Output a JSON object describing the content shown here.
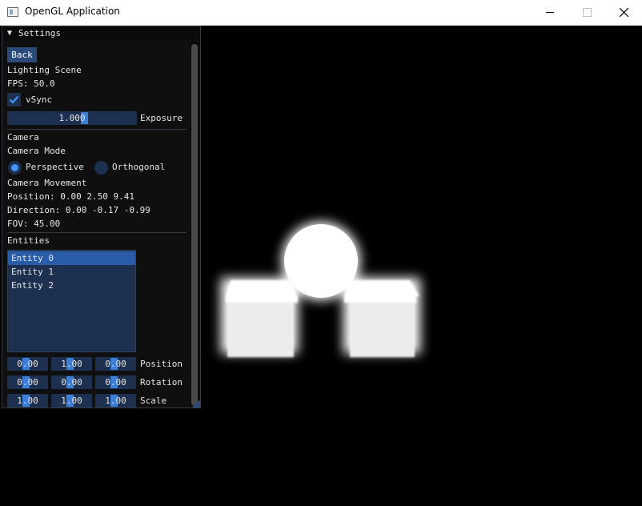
{
  "window": {
    "title": "OpenGL Application",
    "icons": {
      "app": "window-app-icon",
      "minimize": "minimize-icon",
      "maximize": "maximize-icon",
      "close": "close-icon"
    }
  },
  "settings": {
    "title": "Settings",
    "back_label": "Back",
    "scene_name": "Lighting Scene",
    "fps": "FPS: 50.0",
    "vsync_label": "vSync",
    "vsync_checked": true,
    "exposure_value": "1.000",
    "exposure_label": "Exposure",
    "camera": {
      "header": "Camera",
      "mode_label": "Camera Mode",
      "mode_options": [
        "Perspective",
        "Orthogonal"
      ],
      "selected_mode": "Perspective",
      "movement_label": "Camera Movement",
      "position": "Position: 0.00 2.50 9.41",
      "direction": "Direction: 0.00 -0.17 -0.99",
      "fov": "FOV: 45.00"
    },
    "entities": {
      "header": "Entities",
      "items": [
        "Entity 0",
        "Entity 1",
        "Entity 2"
      ],
      "selected": "Entity 0",
      "position": {
        "values": [
          "0.00",
          "1.00",
          "0.00"
        ],
        "label": "Position"
      },
      "rotation": {
        "values": [
          "0.00",
          "0.00",
          "0.00"
        ],
        "label": "Rotation"
      },
      "scale": {
        "values": [
          "1.00",
          "1.00",
          "1.00"
        ],
        "label": "Scale"
      }
    }
  },
  "colors": {
    "accent": "#4296fa",
    "frame_bg": "#1d3050",
    "button": "#2a4a7a",
    "window_bg": "#0f0f0f"
  }
}
